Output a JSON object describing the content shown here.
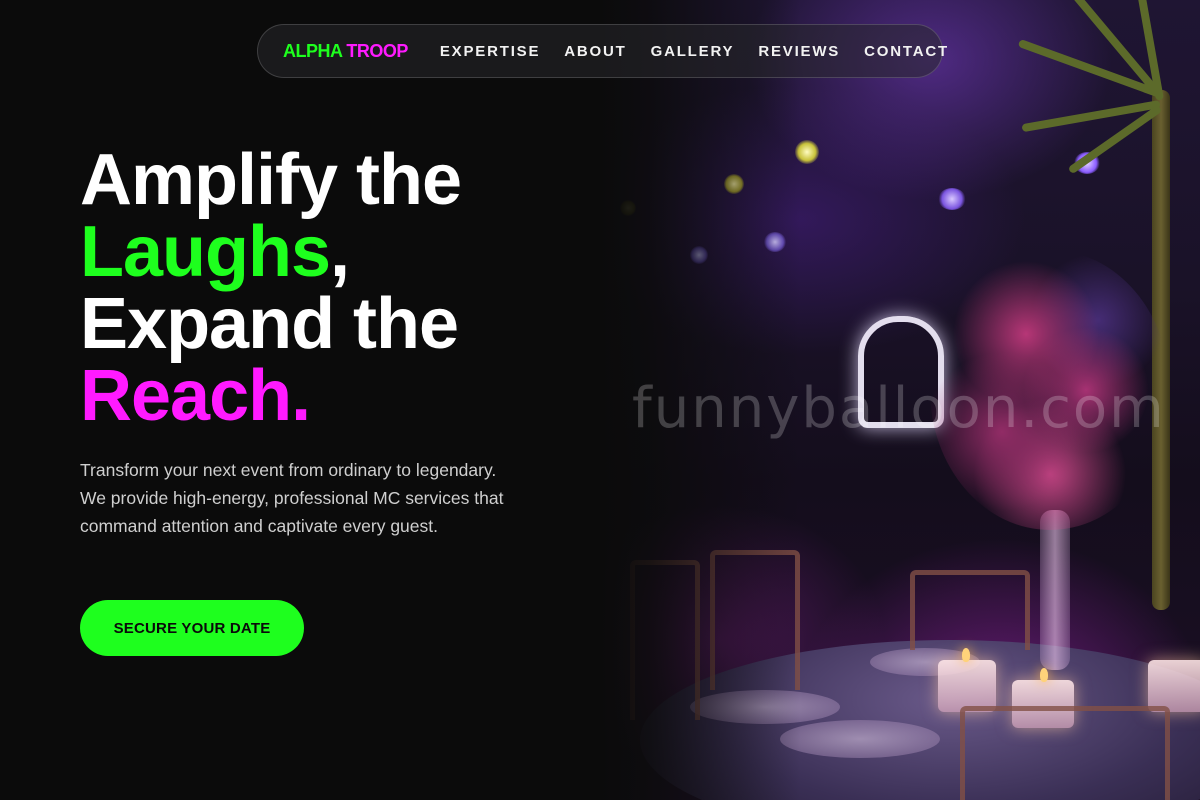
{
  "nav": {
    "logo_part1": "ALPHA",
    "logo_part2": "TROOP",
    "links": [
      "EXPERTISE",
      "ABOUT",
      "GALLERY",
      "REVIEWS",
      "CONTACT"
    ]
  },
  "hero": {
    "headline_line1": "Amplify the",
    "headline_word2": "Laughs",
    "headline_punct2": ",",
    "headline_line3": "Expand the",
    "headline_word4": "Reach",
    "headline_punct4": ".",
    "lead": "Transform your next event from ordinary to legendary. We provide high-energy, professional MC services that command attention and captivate every guest.",
    "cta_label": "SECURE YOUR DATE",
    "watermark": "funnyballoon.com"
  },
  "colors": {
    "accent_green": "#1eff1e",
    "accent_pink": "#ff1aff",
    "background": "#0b0b0b"
  }
}
